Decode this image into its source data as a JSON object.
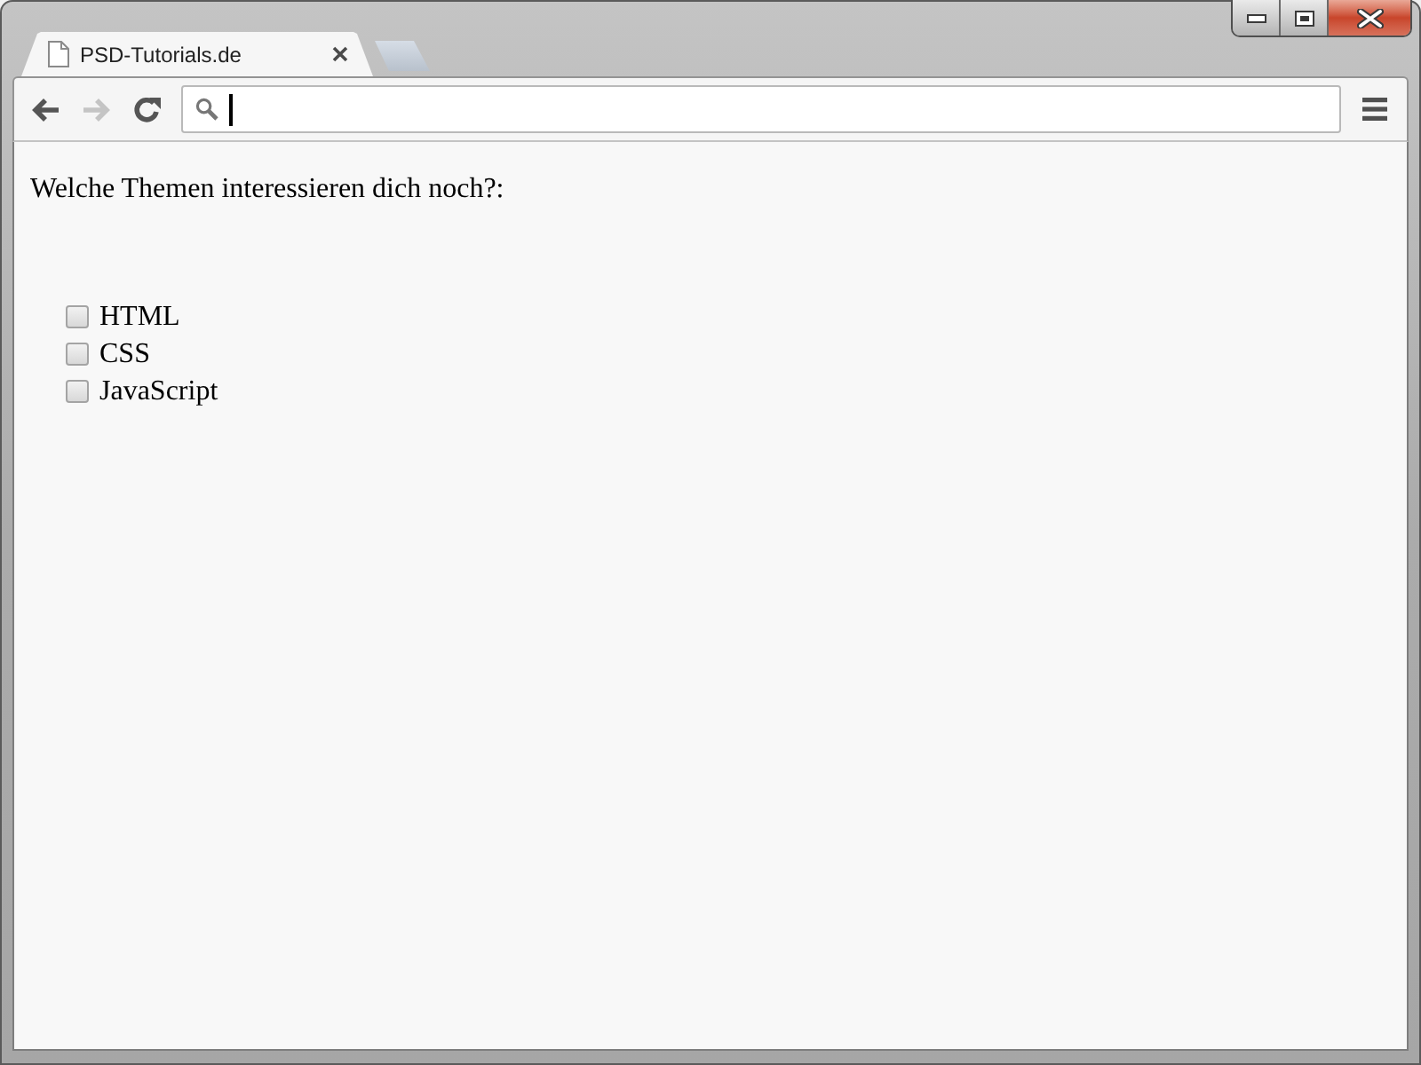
{
  "window": {
    "tab": {
      "title": "PSD-Tutorials.de",
      "selected": true
    }
  },
  "toolbar": {
    "back_button": {
      "disabled": false
    },
    "forward_button": {
      "disabled": true
    },
    "address_bar": {
      "focused": true
    }
  },
  "page": {
    "question": "Welche Themen interessieren dich noch?:",
    "options": [
      {
        "label": "HTML",
        "checked": false
      },
      {
        "label": "CSS",
        "checked": false
      },
      {
        "label": "JavaScript",
        "checked": false
      }
    ]
  }
}
